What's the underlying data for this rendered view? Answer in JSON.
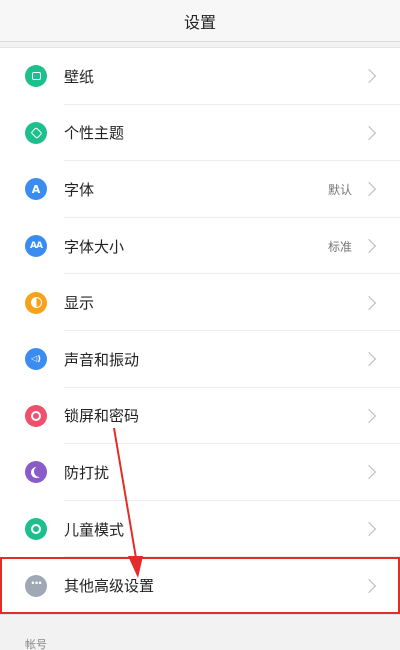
{
  "header": {
    "title": "设置"
  },
  "settings": [
    {
      "label": "壁纸",
      "value": "",
      "icon": "wallpaper-icon",
      "color": "#1dbf8c"
    },
    {
      "label": "个性主题",
      "value": "",
      "icon": "theme-brush-icon",
      "color": "#1dbf8c"
    },
    {
      "label": "字体",
      "value": "默认",
      "icon": "font-icon",
      "color": "#3b8cf0",
      "glyph": "A"
    },
    {
      "label": "字体大小",
      "value": "标准",
      "icon": "font-size-icon",
      "color": "#3b8cf0",
      "glyph": "AA"
    },
    {
      "label": "显示",
      "value": "",
      "icon": "display-brightness-icon",
      "color": "#f6a21b"
    },
    {
      "label": "声音和振动",
      "value": "",
      "icon": "speaker-icon",
      "color": "#3b8cf0",
      "glyph": "◁)"
    },
    {
      "label": "锁屏和密码",
      "value": "",
      "icon": "lock-icon",
      "color": "#f0506e"
    },
    {
      "label": "防打扰",
      "value": "",
      "icon": "moon-icon",
      "color": "#8a5cc9"
    },
    {
      "label": "儿童模式",
      "value": "",
      "icon": "kids-mode-icon",
      "color": "#1dbf8c"
    },
    {
      "label": "其他高级设置",
      "value": "",
      "icon": "more-dots-icon",
      "color": "#a0a8b5"
    }
  ],
  "section": {
    "account_label": "帐号"
  },
  "annotation": {
    "highlight_color": "#e52a2a",
    "arrow_color": "#e52a2a"
  }
}
